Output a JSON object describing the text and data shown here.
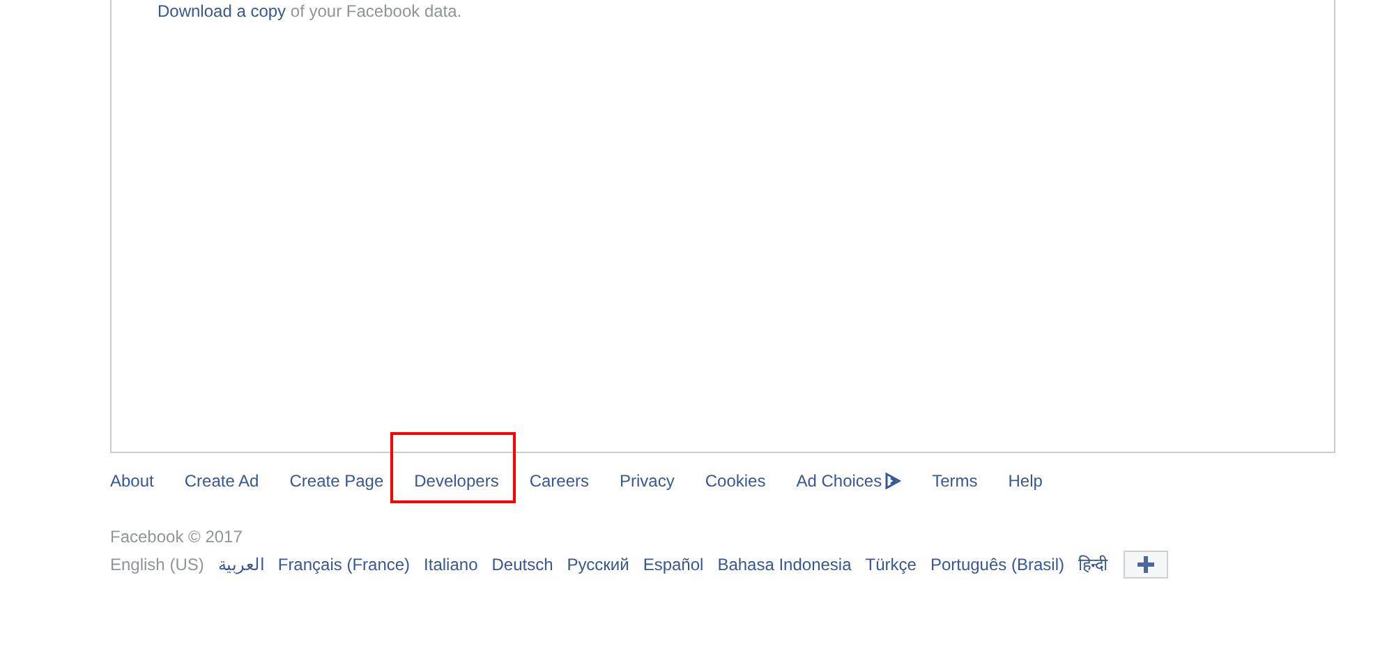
{
  "panel": {
    "download_link": "Download a copy",
    "download_rest": " of your Facebook data."
  },
  "footer_links": [
    {
      "label": "About",
      "highlighted": false
    },
    {
      "label": "Create Ad",
      "highlighted": false
    },
    {
      "label": "Create Page",
      "highlighted": false
    },
    {
      "label": "Developers",
      "highlighted": true
    },
    {
      "label": "Careers",
      "highlighted": false
    },
    {
      "label": "Privacy",
      "highlighted": false
    },
    {
      "label": "Cookies",
      "highlighted": false
    },
    {
      "label": "Ad Choices",
      "highlighted": false,
      "kind": "adchoices"
    },
    {
      "label": "Terms",
      "highlighted": false
    },
    {
      "label": "Help",
      "highlighted": false
    }
  ],
  "copyright": "Facebook © 2017",
  "languages": [
    {
      "label": "English (US)",
      "selected": true
    },
    {
      "label": "العربية",
      "selected": false
    },
    {
      "label": "Français (France)",
      "selected": false
    },
    {
      "label": "Italiano",
      "selected": false
    },
    {
      "label": "Deutsch",
      "selected": false
    },
    {
      "label": "Русский",
      "selected": false
    },
    {
      "label": "Español",
      "selected": false
    },
    {
      "label": "Bahasa Indonesia",
      "selected": false
    },
    {
      "label": "Türkçe",
      "selected": false
    },
    {
      "label": "Português (Brasil)",
      "selected": false
    },
    {
      "label": "हिन्दी",
      "selected": false
    }
  ]
}
